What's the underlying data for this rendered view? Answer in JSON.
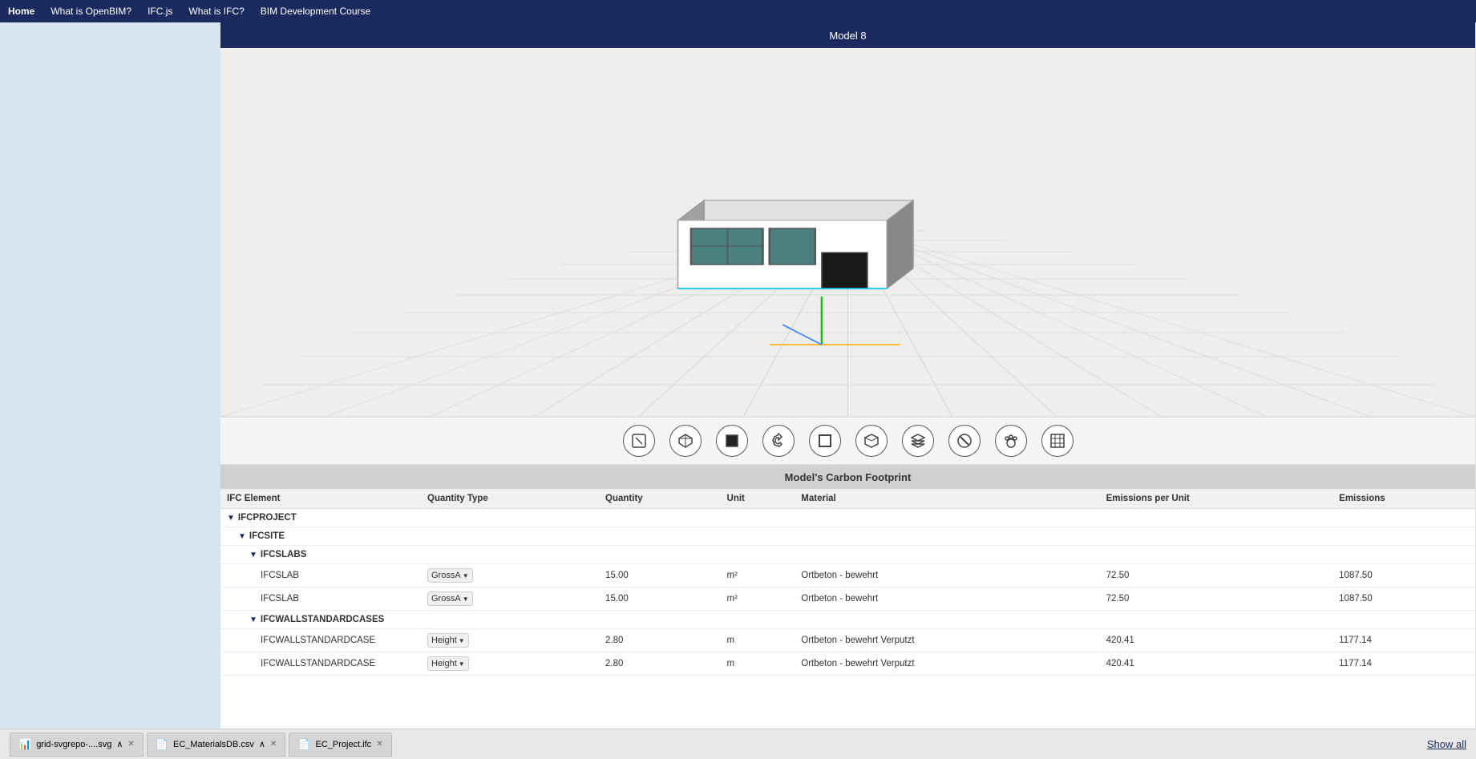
{
  "nav": {
    "items": [
      {
        "label": "Home",
        "active": true
      },
      {
        "label": "What is OpenBIM?",
        "active": false
      },
      {
        "label": "IFC.js",
        "active": false
      },
      {
        "label": "What is IFC?",
        "active": false
      },
      {
        "label": "BIM Development Course",
        "active": false
      }
    ]
  },
  "model": {
    "title": "Model 8"
  },
  "carbon": {
    "title": "Model's Carbon Footprint"
  },
  "toolbar": {
    "buttons": [
      {
        "name": "pencil-icon",
        "symbol": "✏️"
      },
      {
        "name": "cube-icon",
        "symbol": "⬡"
      },
      {
        "name": "square-icon",
        "symbol": "■"
      },
      {
        "name": "rotate-icon",
        "symbol": "⟳"
      },
      {
        "name": "frame-icon",
        "symbol": "▢"
      },
      {
        "name": "box-icon",
        "symbol": "◈"
      },
      {
        "name": "layers-icon",
        "symbol": "◫"
      },
      {
        "name": "cancel-icon",
        "symbol": "⊗"
      },
      {
        "name": "paw-icon",
        "symbol": "🐾"
      },
      {
        "name": "grid-icon",
        "symbol": "⊞"
      }
    ]
  },
  "table": {
    "columns": [
      "IFC Element",
      "Quantity Type",
      "Quantity",
      "Unit",
      "Material",
      "Emissions per Unit",
      "Emissions"
    ],
    "rows": [
      {
        "type": "group",
        "level": 0,
        "label": "IFCPROJECT",
        "triangle": true
      },
      {
        "type": "group",
        "level": 1,
        "label": "IFCSITE",
        "triangle": true
      },
      {
        "type": "group",
        "level": 2,
        "label": "IFCSLABS",
        "triangle": true
      },
      {
        "type": "data",
        "level": 3,
        "label": "IFCSLAB",
        "qtype": "GrossA",
        "qty": "15.00",
        "unit": "m²",
        "material": "Ortbeton - bewehrt",
        "epu": "72.50",
        "emissions": "1087.50"
      },
      {
        "type": "data",
        "level": 3,
        "label": "IFCSLAB",
        "qtype": "GrossA",
        "qty": "15.00",
        "unit": "m²",
        "material": "Ortbeton - bewehrt",
        "epu": "72.50",
        "emissions": "1087.50"
      },
      {
        "type": "group",
        "level": 2,
        "label": "IFCWALLSTANDARDCASES",
        "triangle": true
      },
      {
        "type": "data",
        "level": 3,
        "label": "IFCWALLSTANDARDCASE",
        "qtype": "Height",
        "qty": "2.80",
        "unit": "m",
        "material": "Ortbeton - bewehrt Verputzt",
        "epu": "420.41",
        "emissions": "1177.14"
      },
      {
        "type": "data",
        "level": 3,
        "label": "IFCWALLSTANDARDCASE",
        "qtype": "Height",
        "qty": "2.80",
        "unit": "m",
        "material": "Ortbeton - bewehrt Verputzt",
        "epu": "420.41",
        "emissions": "1177.14"
      }
    ]
  },
  "bottom_bar": {
    "tabs": [
      {
        "name": "grid-svgrepo-svg",
        "icon": "📊",
        "label": "grid-svgrepo-....svg",
        "has_close": true,
        "has_up": true
      },
      {
        "name": "ec-materials-csv",
        "icon": "📄",
        "label": "EC_MaterialsDB.csv",
        "has_close": true,
        "has_up": true
      },
      {
        "name": "ec-project-ifc",
        "icon": "📄",
        "label": "EC_Project.ifc",
        "has_close": true,
        "has_up": false
      }
    ],
    "show_all": "Show all"
  }
}
